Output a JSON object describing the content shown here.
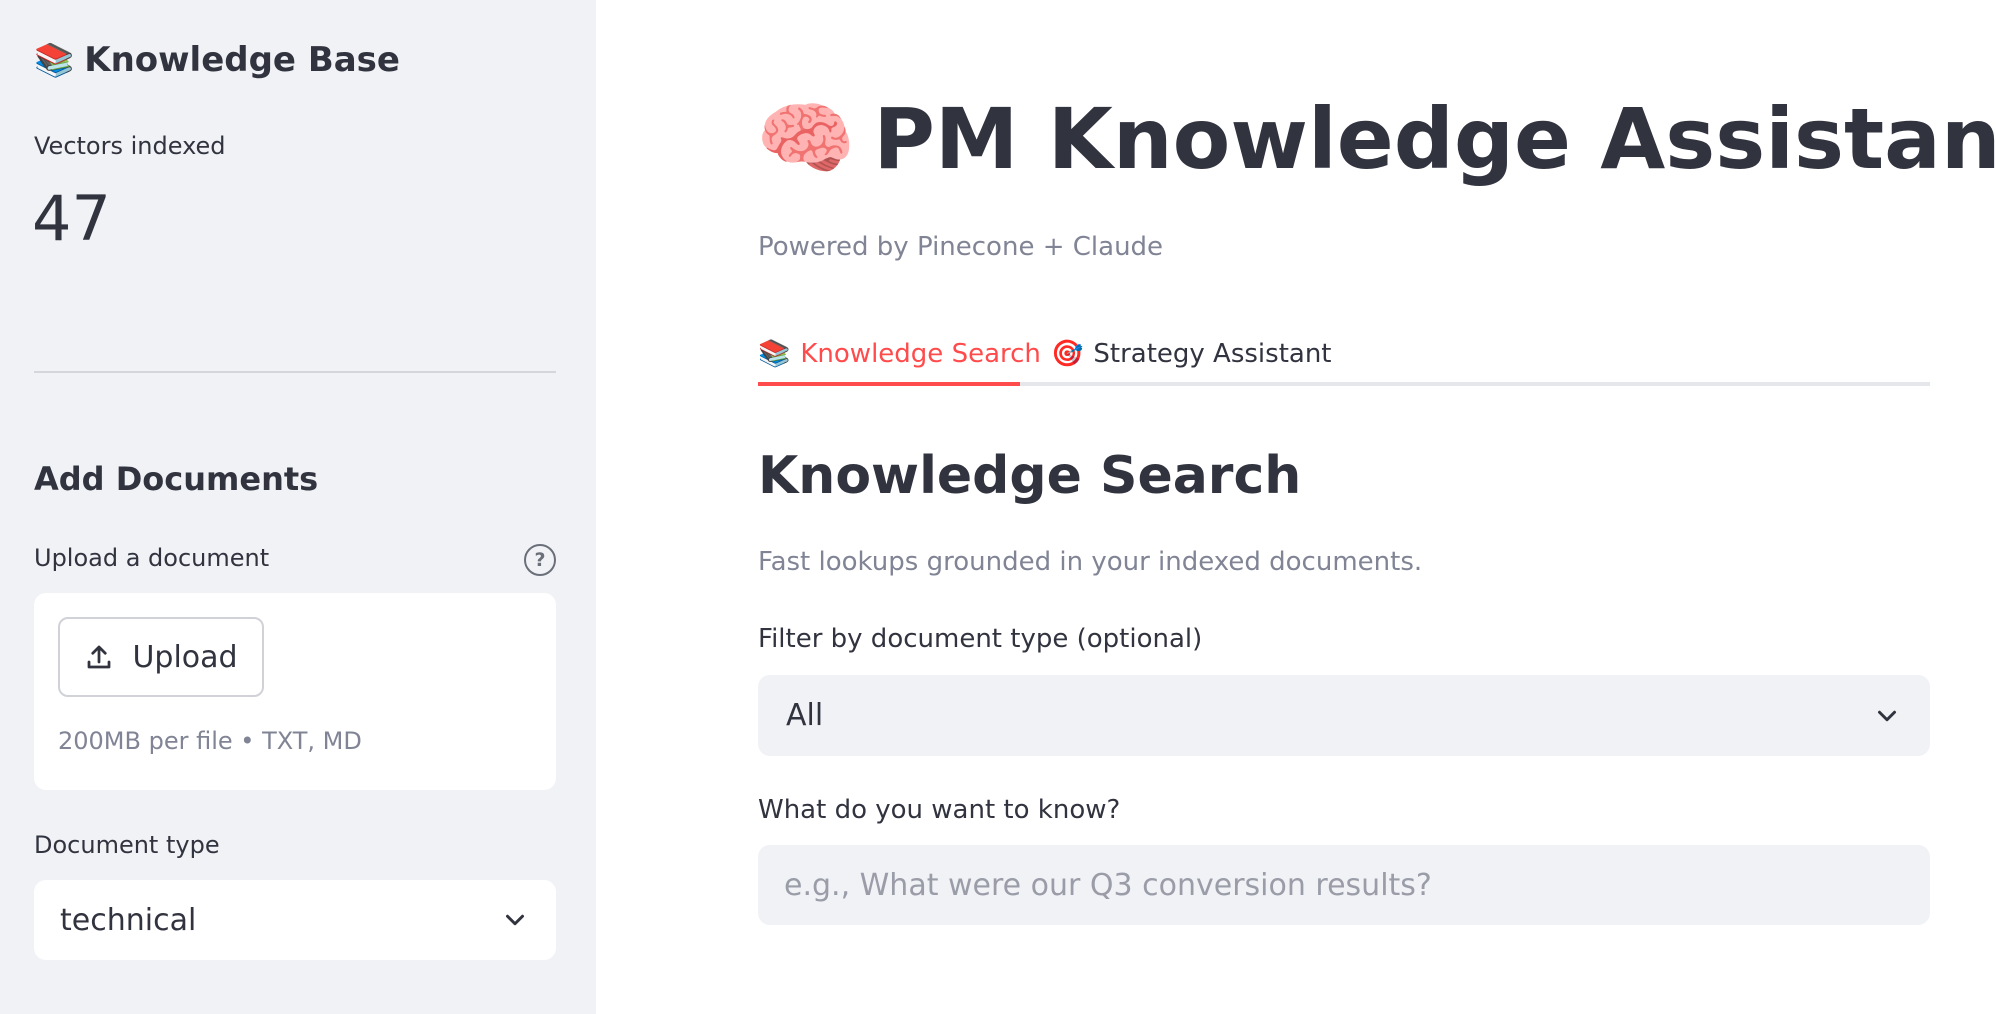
{
  "sidebar": {
    "title_icon": "📚",
    "title": "Knowledge Base",
    "metric_label": "Vectors indexed",
    "metric_value": "47",
    "section_title": "Add Documents",
    "upload_label": "Upload a document",
    "help_icon": "?",
    "upload_button_label": "Upload",
    "upload_note": "200MB per file • TXT, MD",
    "doctype_label": "Document type",
    "doctype_value": "technical"
  },
  "main": {
    "title_icon": "🧠",
    "title": "PM Knowledge Assistant",
    "caption": "Powered by Pinecone + Claude",
    "tabs": [
      {
        "icon": "📚",
        "label": "Knowledge Search",
        "active": true
      },
      {
        "icon": "🎯",
        "label": "Strategy Assistant",
        "active": false
      }
    ],
    "section_title": "Knowledge Search",
    "section_sub": "Fast lookups grounded in your indexed documents.",
    "filter_label": "Filter by document type (optional)",
    "filter_value": "All",
    "question_label": "What do you want to know?",
    "question_placeholder": "e.g., What were our Q3 conversion results?",
    "question_value": ""
  },
  "colors": {
    "accent": "#ff4b4b",
    "sidebar_bg": "#f0f2f6",
    "text": "#31333f",
    "muted": "#808495"
  }
}
